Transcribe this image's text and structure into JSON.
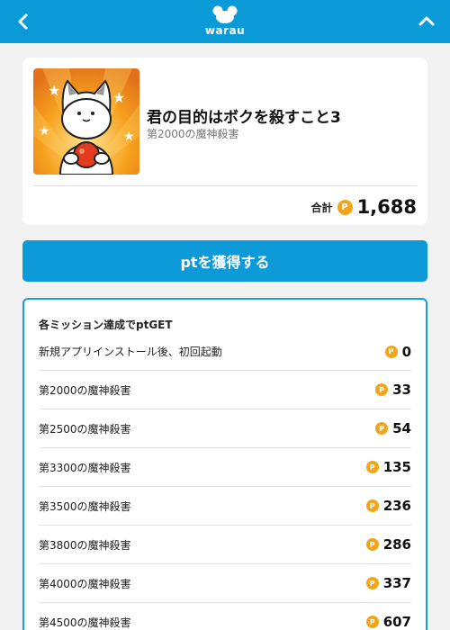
{
  "header": {
    "logo_text": "warau",
    "back_icon": "chevron-left-icon",
    "collapse_icon": "chevron-up-icon",
    "background": "#0a9ad8"
  },
  "app": {
    "title": "君の目的はボクを殺すこと3",
    "subtitle": "第2000の魔神殺害",
    "total_label": "合計",
    "total_points": "1,688",
    "point_icon_glyph": "P"
  },
  "cta": {
    "label": "ptを獲得する",
    "color": "#0d9ad8"
  },
  "missions": {
    "header": "各ミッション達成でptGET",
    "items": [
      {
        "label": "新規アプリインストール後、初回起動",
        "points": "0"
      },
      {
        "label": "第2000の魔神殺害",
        "points": "33"
      },
      {
        "label": "第2500の魔神殺害",
        "points": "54"
      },
      {
        "label": "第3300の魔神殺害",
        "points": "135"
      },
      {
        "label": "第3500の魔神殺害",
        "points": "236"
      },
      {
        "label": "第3800の魔神殺害",
        "points": "286"
      },
      {
        "label": "第4000の魔神殺害",
        "points": "337"
      },
      {
        "label": "第4500の魔神殺害",
        "points": "607"
      }
    ]
  },
  "colors": {
    "accent": "#0d9ad8",
    "coin": "#f1a51a",
    "mission_border": "#18a0d8"
  }
}
